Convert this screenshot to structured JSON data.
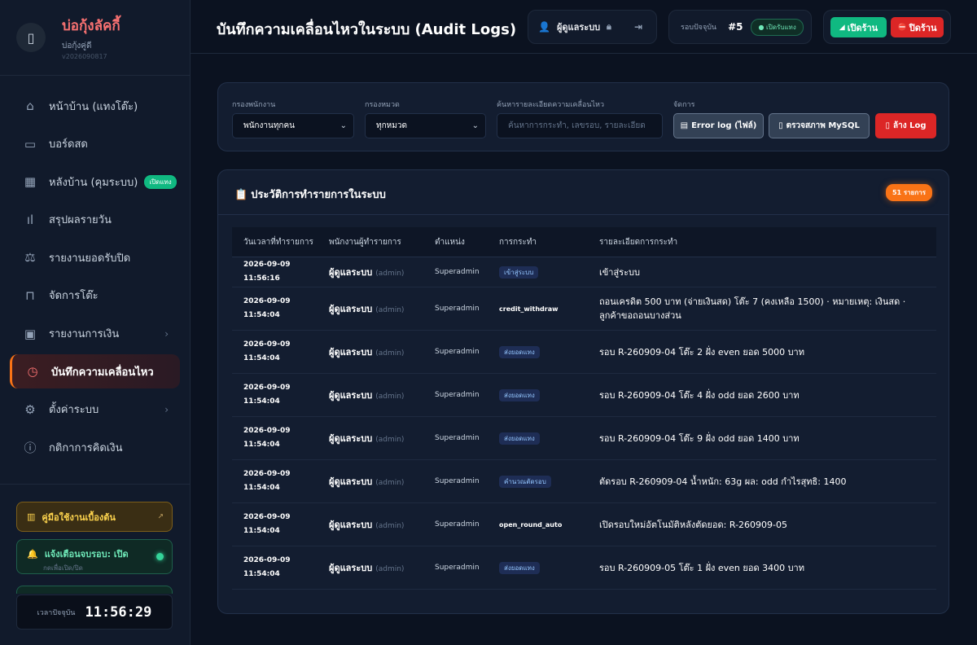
{
  "brand": {
    "name": "บ่อกุ้งลัคกี้",
    "sub": "บ่อกุ้งคู่ดี",
    "version": "v2026090817",
    "logo_icon": "book-icon"
  },
  "sidebar": {
    "items": [
      {
        "label": "หน้าบ้าน (แทงโต๊ะ)",
        "icon": "⌂",
        "icon_name": "home-icon"
      },
      {
        "label": "บอร์ดสด",
        "icon": "▭",
        "icon_name": "monitor-icon"
      },
      {
        "label": "หลังบ้าน (คุมระบบ)",
        "icon": "▦",
        "icon_name": "layout-icon",
        "badge": "เปิดแทง"
      },
      {
        "label": "สรุปผลรายวัน",
        "icon": "ıl",
        "icon_name": "bar-chart-icon"
      },
      {
        "label": "รายงานยอดรับปิด",
        "icon": "⚖",
        "icon_name": "scale-icon"
      },
      {
        "label": "จัดการโต๊ะ",
        "icon": "⊓",
        "icon_name": "table-icon"
      },
      {
        "label": "รายงานการเงิน",
        "icon": "▣",
        "icon_name": "wallet-icon",
        "chevron": "›"
      },
      {
        "label": "บันทึกความเคลื่อนไหว",
        "icon": "◷",
        "icon_name": "clock-icon",
        "active": true
      },
      {
        "label": "ตั้งค่าระบบ",
        "icon": "⚙",
        "icon_name": "gear-icon",
        "chevron": "›"
      },
      {
        "label": "กติกาการคิดเงิน",
        "icon": "ⓘ",
        "icon_name": "info-icon"
      }
    ],
    "guide_label": "คู่มือใช้งานเบื้องต้น",
    "notify_title": "แจ้งเตือนจบรอบ: เปิด",
    "notify_sub": "กดเพื่อเปิด/ปิด",
    "clock_label": "เวลาปัจจุบัน",
    "clock_value": "11:56:29"
  },
  "header": {
    "title": "บันทึกความเคลื่อนไหวในระบบ (Audit Logs)",
    "user": "ผู้ดูแลระบบ",
    "round_label": "รอบปัจจุบัน",
    "round_number": "#5",
    "round_status": "เปิดรับแทง",
    "open_shop": "เปิดร้าน",
    "close_shop": "ปิดร้าน"
  },
  "filters": {
    "staff_label": "กรองพนักงาน",
    "staff_value": "พนักงานทุกคน",
    "category_label": "กรองหมวด",
    "category_value": "ทุกหมวด",
    "search_label": "ค้นหารายละเอียดความเคลื่อนไหว",
    "search_placeholder": "ค้นหาการกระทำ, เลขรอบ, รายละเอียด",
    "manage_label": "จัดการ",
    "error_log": "Error log (ไฟล์)",
    "check_db": "ตรวจสภาพ MySQL",
    "clear_log": "ล้าง Log"
  },
  "table": {
    "title": "ประวัติการทำรายการในระบบ",
    "count_badge": "51 รายการ",
    "headers": [
      "วันเวลาที่ทำรายการ",
      "พนักงานผู้ทำรายการ",
      "ตำแหน่ง",
      "การกระทำ",
      "รายละเอียดการกระทำ"
    ],
    "rows": [
      {
        "time": "2026-09-09 11:56:16",
        "user": "ผู้ดูแลระบบ",
        "username": "(admin)",
        "role": "Superadmin",
        "action": "เข้าสู่ระบบ",
        "action_style": "tag",
        "detail": "เข้าสู่ระบบ"
      },
      {
        "time": "2026-09-09 11:54:04",
        "user": "ผู้ดูแลระบบ",
        "username": "(admin)",
        "role": "Superadmin",
        "action": "credit_withdraw",
        "action_style": "plain",
        "detail": "ถอนเครดิต 500 บาท (จ่ายเงินสด) โต๊ะ 7 (คงเหลือ 1500) · หมายเหตุ: เงินสด · ลูกค้าขอถอนบางส่วน"
      },
      {
        "time": "2026-09-09 11:54:04",
        "user": "ผู้ดูแลระบบ",
        "username": "(admin)",
        "role": "Superadmin",
        "action": "ส่งยอดแทง",
        "action_style": "tag",
        "detail": "รอบ R-260909-04 โต๊ะ 2 ฝั่ง even ยอด 5000 บาท"
      },
      {
        "time": "2026-09-09 11:54:04",
        "user": "ผู้ดูแลระบบ",
        "username": "(admin)",
        "role": "Superadmin",
        "action": "ส่งยอดแทง",
        "action_style": "tag",
        "detail": "รอบ R-260909-04 โต๊ะ 4 ฝั่ง odd ยอด 2600 บาท"
      },
      {
        "time": "2026-09-09 11:54:04",
        "user": "ผู้ดูแลระบบ",
        "username": "(admin)",
        "role": "Superadmin",
        "action": "ส่งยอดแทง",
        "action_style": "tag",
        "detail": "รอบ R-260909-04 โต๊ะ 9 ฝั่ง odd ยอด 1400 บาท"
      },
      {
        "time": "2026-09-09 11:54:04",
        "user": "ผู้ดูแลระบบ",
        "username": "(admin)",
        "role": "Superadmin",
        "action": "คำนวณตัดรอบ",
        "action_style": "tag",
        "detail": "ตัดรอบ R-260909-04 น้ำหนัก: 63g ผล: odd กำไรสุทธิ: 1400"
      },
      {
        "time": "2026-09-09 11:54:04",
        "user": "ผู้ดูแลระบบ",
        "username": "(admin)",
        "role": "Superadmin",
        "action": "open_round_auto",
        "action_style": "plain",
        "detail": "เปิดรอบใหม่อัตโนมัติหลังตัดยอด: R-260909-05"
      },
      {
        "time": "2026-09-09 11:54:04",
        "user": "ผู้ดูแลระบบ",
        "username": "(admin)",
        "role": "Superadmin",
        "action": "ส่งยอดแทง",
        "action_style": "tag",
        "detail": "รอบ R-260909-05 โต๊ะ 1 ฝั่ง even ยอด 3400 บาท"
      }
    ]
  }
}
